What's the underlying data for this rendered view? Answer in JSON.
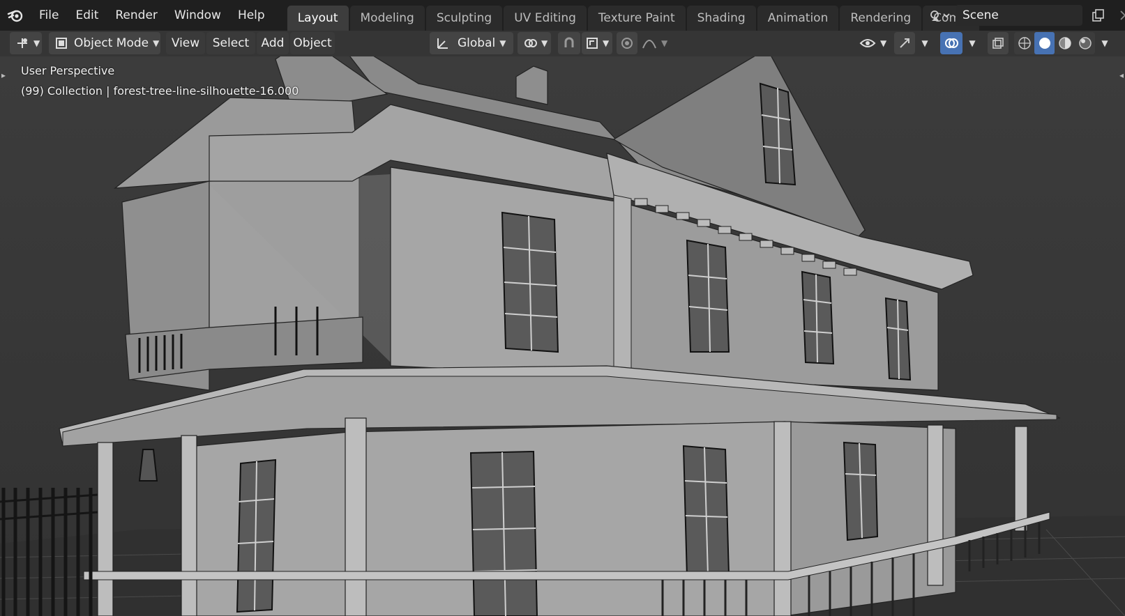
{
  "menu": {
    "file": "File",
    "edit": "Edit",
    "render": "Render",
    "window": "Window",
    "help": "Help"
  },
  "workspaces": [
    "Layout",
    "Modeling",
    "Sculpting",
    "UV Editing",
    "Texture Paint",
    "Shading",
    "Animation",
    "Rendering",
    "Compos"
  ],
  "scene": {
    "name": "Scene"
  },
  "header": {
    "mode": "Object Mode",
    "view": "View",
    "select": "Select",
    "add": "Add",
    "object": "Object",
    "orientation": "Global"
  },
  "viewport": {
    "perspective": "User Perspective",
    "collection_info": "(99) Collection | forest-tree-line-silhouette-16.000"
  },
  "colors": {
    "topbar": "#1f1f1f",
    "accent": "#4772b3",
    "viewport_bg": "#3a3a3a"
  },
  "icons": [
    "blender-logo-icon",
    "scene-icon",
    "new-window-icon",
    "close-icon",
    "editor-type-icon",
    "object-mode-icon",
    "transform-orientation-icon",
    "pivot-icon",
    "snap-icon",
    "proportional-edit-icon",
    "visibility-icon",
    "gizmo-icon",
    "overlay-icon",
    "xray-icon",
    "wireframe-shading-icon",
    "solid-shading-icon",
    "material-shading-icon",
    "rendered-shading-icon"
  ]
}
